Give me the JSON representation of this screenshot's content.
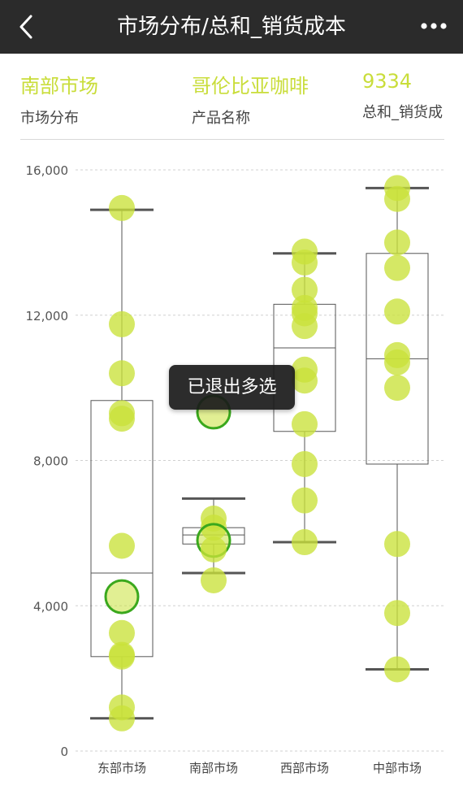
{
  "header": {
    "title": "市场分布/总和_销货成本",
    "back_icon": "chevron-left-icon",
    "more_icon": "more-dots-icon"
  },
  "info": {
    "market_value": "南部市场",
    "market_label": "市场分布",
    "product_value": "哥伦比亚咖啡",
    "product_label": "产品名称",
    "cost_value": "9334",
    "cost_label": "总和_销货成"
  },
  "toast": {
    "text": "已退出多选"
  },
  "colors": {
    "point": "#c9e23a",
    "selected_ring": "#3aa81d",
    "accent_text": "#c9dd3a",
    "box_line": "#555555"
  },
  "chart_data": {
    "type": "boxplot",
    "categories": [
      "东部市场",
      "南部市场",
      "西部市场",
      "中部市场"
    ],
    "ylim": [
      0,
      16000
    ],
    "yticks": [
      "0",
      "4,000",
      "8,000",
      "12,000",
      "16,000"
    ],
    "ytick_values": [
      0,
      4000,
      8000,
      12000,
      16000
    ],
    "grid": true,
    "boxes": [
      {
        "whisker_low": 900,
        "q1": 2600,
        "median": 4900,
        "q3": 9650,
        "whisker_high": 14900
      },
      {
        "whisker_low": 4900,
        "q1": 5700,
        "median": 5950,
        "q3": 6150,
        "whisker_high": 6950
      },
      {
        "whisker_low": 5750,
        "q1": 8800,
        "median": 11100,
        "q3": 12300,
        "whisker_high": 13700
      },
      {
        "whisker_low": 2250,
        "q1": 7900,
        "median": 10800,
        "q3": 13700,
        "whisker_high": 15500
      }
    ],
    "points": [
      [
        14950,
        11750,
        10400,
        9300,
        9150,
        5650,
        4250,
        3250,
        2650,
        2600,
        1200,
        900
      ],
      [
        9334,
        6400,
        6150,
        5800,
        5550,
        4700
      ],
      [
        13750,
        13450,
        12700,
        12200,
        12050,
        11700,
        10500,
        10200,
        9000,
        7900,
        6900,
        5750
      ],
      [
        15500,
        15200,
        14000,
        13300,
        12100,
        10900,
        10700,
        10000,
        5700,
        3800,
        2250
      ]
    ],
    "selected_points": [
      [
        1,
        0
      ],
      [
        1,
        3
      ],
      [
        0,
        6
      ]
    ]
  }
}
